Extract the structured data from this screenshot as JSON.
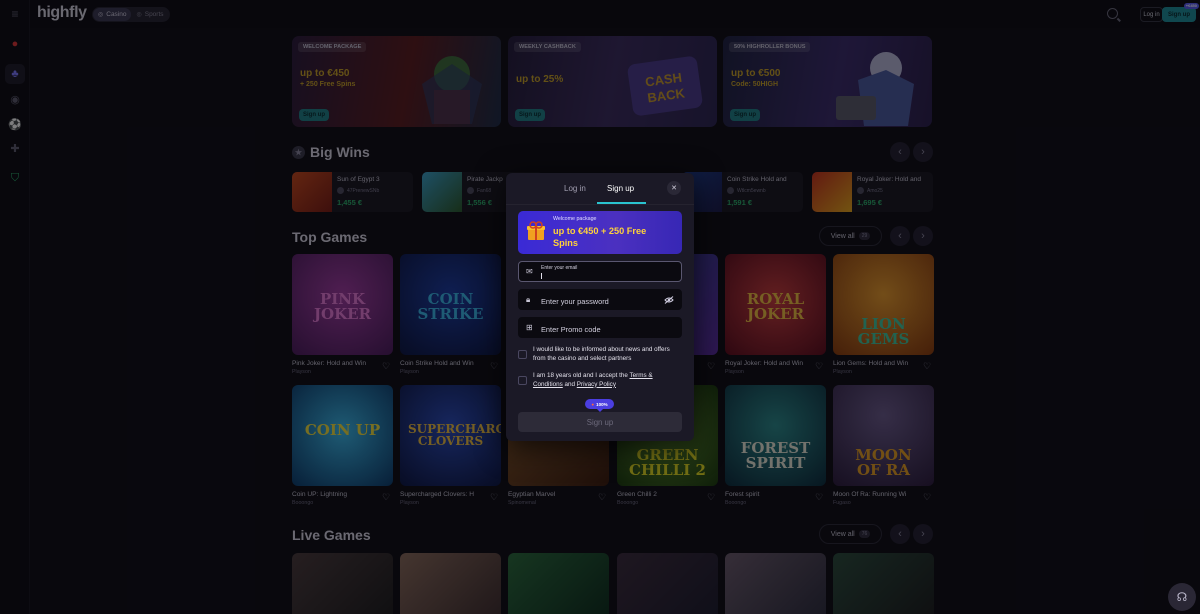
{
  "brand": {
    "logo": "highfly"
  },
  "topbar": {
    "modes": [
      {
        "label": "Casino",
        "icon": "casino-chip-icon"
      },
      {
        "label": "Sports",
        "icon": "sports-ball-icon"
      }
    ],
    "login_label": "Log in",
    "signup_label": "Sign up",
    "signup_badge": "+€450"
  },
  "sidebar": {
    "icons": [
      "menu-icon",
      "cherry-icon",
      "casino-icon",
      "live-icon",
      "sports-icon",
      "gamepad-icon",
      "shield-icon"
    ]
  },
  "promos": [
    {
      "tag": "WELCOME PACKAGE",
      "line1": "up to €450",
      "line2": "+ 250 Free Spins",
      "cta": "Sign up"
    },
    {
      "tag": "WEEKLY CASHBACK",
      "line1": "up to 25%",
      "line2": "",
      "cta": "Sign up"
    },
    {
      "tag": "50% HIGHROLLER BONUS",
      "line1": "up to €500",
      "line2": "Code: 50HIGH",
      "cta": "Sign up"
    }
  ],
  "big_wins": {
    "title": "Big Wins",
    "items": [
      {
        "game": "Sun of Egypt 3",
        "user": "47PrenewSNb",
        "amount": "1,455 €"
      },
      {
        "game": "Pirate Jackp",
        "user": "Fan68",
        "amount": "1,556 €"
      },
      {
        "game": "Coin Strike Hold and",
        "user": "Wtlcm5ewnb",
        "amount": "1,591 €"
      },
      {
        "game": "Royal Joker: Hold and",
        "user": "Amo25",
        "amount": "1,695 €"
      }
    ]
  },
  "top_games": {
    "title": "Top Games",
    "view_all": "View all",
    "count": "29",
    "row1": [
      {
        "name": "Pink Joker: Hold and Win",
        "provider": "Playson"
      },
      {
        "name": "Coin Strike Hold and Win",
        "provider": "Playson"
      },
      {
        "name": "",
        "provider": ""
      },
      {
        "name": "",
        "provider": ""
      },
      {
        "name": "Royal Joker: Hold and Win",
        "provider": "Playson"
      },
      {
        "name": "Lion Gems: Hold and Win",
        "provider": "Playson"
      }
    ],
    "row2": [
      {
        "name": "Coin UP: Lightning",
        "provider": "Booongo"
      },
      {
        "name": "Supercharged Clovers: H",
        "provider": "Playson"
      },
      {
        "name": "Egyptian Marvel",
        "provider": "Spinomenal"
      },
      {
        "name": "Green Chilli 2",
        "provider": "Booongo"
      },
      {
        "name": "Forest spirit",
        "provider": "Booongo"
      },
      {
        "name": "Moon Of Ra: Running Wi",
        "provider": "Fugaso"
      }
    ]
  },
  "live_games": {
    "title": "Live Games",
    "view_all": "View all",
    "count": "76"
  },
  "modal": {
    "tab_login": "Log in",
    "tab_signup": "Sign up",
    "banner_label": "Welcome package",
    "banner_value": "up to €450 + 250 Free Spins",
    "email_label": "Enter your email",
    "password_placeholder": "Enter your password",
    "promo_placeholder": "Enter Promo code",
    "check1": "I would like to be informed about news and offers from the casino and select partners",
    "check2_a": "I am 18 years old and I accept the ",
    "check2_terms": "Terms & Conditions",
    "check2_and": " and ",
    "check2_privacy": "Privacy Policy",
    "progress": "100%",
    "submit": "Sign up"
  }
}
